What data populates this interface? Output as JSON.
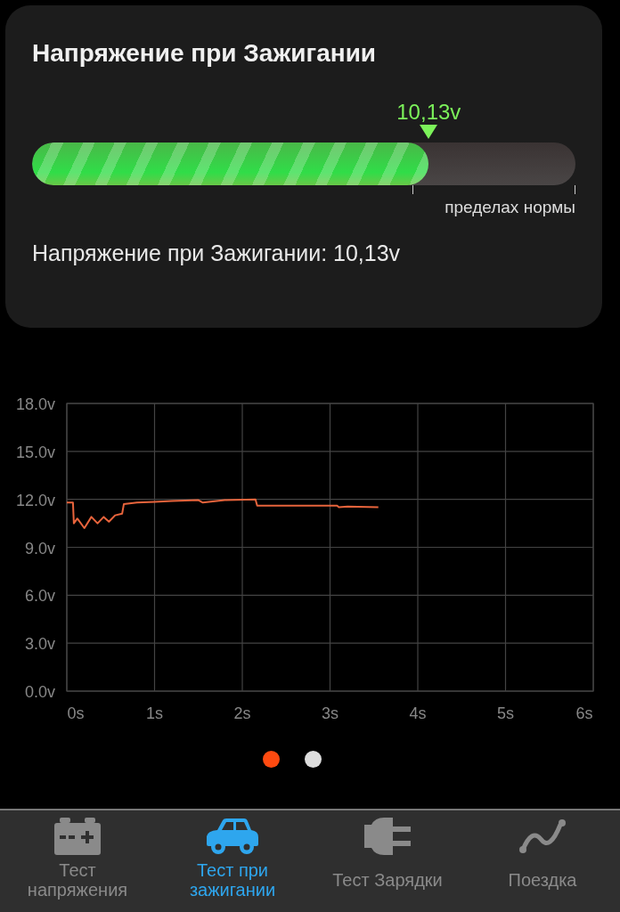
{
  "card": {
    "title": "Напряжение при Зажигании",
    "marker_value": "10,13v",
    "gauge": {
      "level": 0.73
    },
    "range_label": "пределах нормы",
    "reading": "Напряжение при Зажигании: 10,13v"
  },
  "chart": {
    "chart_data": {
      "type": "line",
      "x": [
        0,
        0.07,
        0.08,
        0.12,
        0.2,
        0.28,
        0.35,
        0.42,
        0.48,
        0.55,
        0.63,
        0.65,
        0.8,
        1.0,
        1.2,
        1.5,
        1.55,
        1.8,
        2.15,
        2.17,
        2.5,
        3.08,
        3.1,
        3.2,
        3.55
      ],
      "grid": true,
      "series": [
        {
          "color": "#e8643c",
          "values": [
            11.8,
            11.8,
            10.5,
            10.8,
            10.2,
            10.9,
            10.5,
            10.9,
            10.6,
            11.0,
            11.1,
            11.7,
            11.8,
            11.85,
            11.9,
            11.95,
            11.8,
            11.95,
            12.0,
            11.6,
            11.6,
            11.6,
            11.5,
            11.55,
            11.5
          ]
        }
      ],
      "xlim": [
        0,
        6
      ],
      "ylim": [
        0,
        18
      ],
      "xticks": [
        {
          "value": 0,
          "label": "0s"
        },
        {
          "value": 1,
          "label": "1s"
        },
        {
          "value": 2,
          "label": "2s"
        },
        {
          "value": 3,
          "label": "3s"
        },
        {
          "value": 4,
          "label": "4s"
        },
        {
          "value": 5,
          "label": "5s"
        },
        {
          "value": 6,
          "label": "6s"
        }
      ],
      "yticks": [
        {
          "value": 0,
          "label": "0.0v"
        },
        {
          "value": 3,
          "label": "3.0v"
        },
        {
          "value": 6,
          "label": "6.0v"
        },
        {
          "value": 9,
          "label": "9.0v"
        },
        {
          "value": 12,
          "label": "12.0v"
        },
        {
          "value": 15,
          "label": "15.0v"
        },
        {
          "value": 18,
          "label": "18.0v"
        }
      ]
    }
  },
  "pager": [
    {
      "selected": true
    },
    {
      "selected": false
    }
  ],
  "tabs": [
    {
      "label": "Тест напряжения",
      "selected": false
    },
    {
      "label": "Тест при зажигании",
      "selected": true
    },
    {
      "label": "Тест Зарядки",
      "selected": false
    },
    {
      "label": "Поездка",
      "selected": false
    }
  ]
}
